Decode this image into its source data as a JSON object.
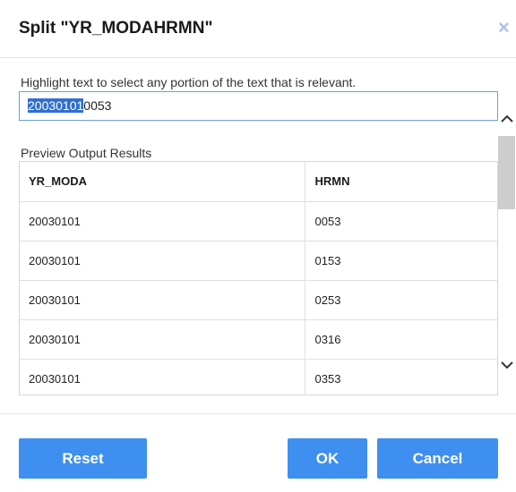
{
  "dialog": {
    "title": "Split \"YR_MODAHRMN\"",
    "close_icon": "×"
  },
  "instruction": "Highlight text to select any portion of the text that is relevant.",
  "input": {
    "selected_text": "20030101",
    "rest_text": "0053"
  },
  "preview": {
    "label": "Preview Output Results",
    "columns": [
      "YR_MODA",
      "HRMN"
    ],
    "rows": [
      [
        "20030101",
        "0053"
      ],
      [
        "20030101",
        "0153"
      ],
      [
        "20030101",
        "0253"
      ],
      [
        "20030101",
        "0316"
      ],
      [
        "20030101",
        "0353"
      ]
    ]
  },
  "scroll": {
    "up": "⌃",
    "down": "⌄"
  },
  "buttons": {
    "reset": "Reset",
    "ok": "OK",
    "cancel": "Cancel"
  },
  "colors": {
    "accent": "#3e8ff0",
    "selection": "#2f6fd1",
    "input_border": "#6ea0d8"
  }
}
